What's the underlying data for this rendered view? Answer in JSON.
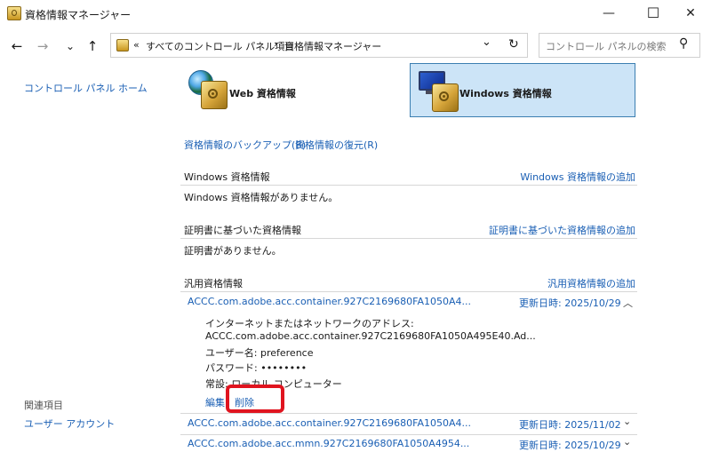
{
  "window": {
    "title": "資格情報マネージャー",
    "minimize": "—",
    "maximize": "☐",
    "close": "✕"
  },
  "nav": {
    "back": "←",
    "forward": "→",
    "recent": "⌄",
    "up": "↑"
  },
  "address": {
    "prefix": "«",
    "crumbs": [
      "すべてのコントロール パネル項目",
      "資格情報マネージャー"
    ],
    "separator": "›",
    "dropdown": "⌄",
    "refresh": "↻"
  },
  "search": {
    "placeholder": "コントロール パネルの検索",
    "icon": "⚲"
  },
  "sidebar": {
    "home_link": "コントロール パネル ホーム",
    "related_heading": "関連項目",
    "related_links": [
      "ユーザー アカウント"
    ]
  },
  "tiles": {
    "web_label": "Web 資格情報",
    "windows_label": "Windows 資格情報"
  },
  "actions": {
    "backup": "資格情報のバックアップ(B)",
    "restore": "資格情報の復元(R)"
  },
  "sections": {
    "windows": {
      "title": "Windows 資格情報",
      "add": "Windows 資格情報の追加",
      "empty": "Windows 資格情報がありません。"
    },
    "certificate": {
      "title": "証明書に基づいた資格情報",
      "add": "証明書に基づいた資格情報の追加",
      "empty": "証明書がありません。"
    },
    "generic": {
      "title": "汎用資格情報",
      "add": "汎用資格情報の追加"
    }
  },
  "generic_items": [
    {
      "name": "ACCC.com.adobe.acc.container.927C2169680FA1050A4...",
      "modified": "更新日時: 2025/10/29",
      "expanded_toggle": "︿",
      "details": {
        "address_label": "インターネットまたはネットワークのアドレス:",
        "address_value": "ACCC.com.adobe.acc.container.927C2169680FA1050A495E40.Ad...",
        "user": "ユーザー名: preference",
        "password": "パスワード: ••••••••",
        "persistence": "常設: ローカル コンピューター"
      },
      "edit": "編集",
      "delete": "削除"
    },
    {
      "name": "ACCC.com.adobe.acc.container.927C2169680FA1050A4...",
      "modified": "更新日時: 2025/11/02",
      "toggle": "⌄"
    },
    {
      "name": "ACCC.com.adobe.acc.mmn.927C2169680FA1050A4954...",
      "modified": "更新日時: 2025/10/29",
      "toggle": "⌄"
    }
  ],
  "colors": {
    "link": "#1a5fb4",
    "selected_tile_bg": "#cce4f7",
    "selected_tile_border": "#3c7fb1",
    "highlight": "#e0141f"
  }
}
